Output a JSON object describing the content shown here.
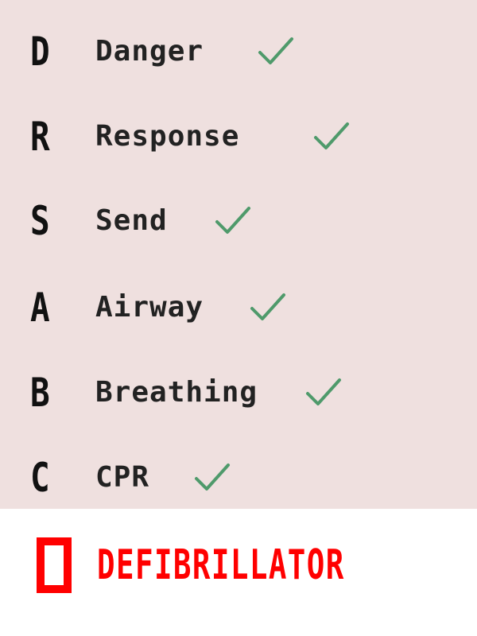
{
  "steps": [
    {
      "letter": "D",
      "word": "Danger",
      "status": "check-icon"
    },
    {
      "letter": "R",
      "word": "Response",
      "status": "check-icon"
    },
    {
      "letter": "S",
      "word": "Send",
      "status": "check-icon"
    },
    {
      "letter": "A",
      "word": "Airway",
      "status": "check-icon"
    },
    {
      "letter": "B",
      "word": "Breathing",
      "status": "check-icon"
    },
    {
      "letter": "C",
      "word": "CPR",
      "status": "check-icon"
    }
  ],
  "final_step": {
    "letter": "D",
    "word": "DEFIBRILLATOR"
  },
  "colors": {
    "panel_background": "#efe0df",
    "text": "#222222",
    "check": "#4f9a6b",
    "final": "#ff0000"
  }
}
